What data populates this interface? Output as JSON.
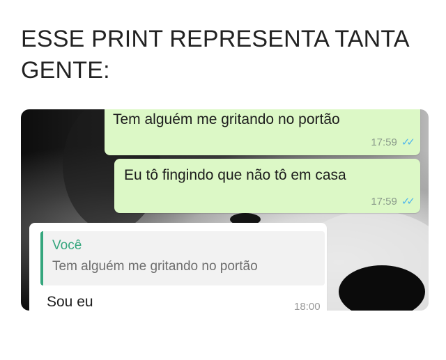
{
  "caption": "ESSE PRINT REPRESENTA TANTA GENTE:",
  "messages": [
    {
      "text": "Tem alguém me gritando no portão",
      "time": "17:59",
      "ticks": "✓✓"
    },
    {
      "text": "Eu tô fingindo que não tô em casa",
      "time": "17:59",
      "ticks": "✓✓"
    }
  ],
  "reply": {
    "quoted_author": "Você",
    "quoted_text": "Tem alguém me gritando no portão",
    "text": "Sou eu",
    "time": "18:00"
  },
  "colors": {
    "outgoing_bubble": "#dcf8c6",
    "quote_accent": "#35a67d",
    "read_ticks": "#4fb6ec"
  }
}
